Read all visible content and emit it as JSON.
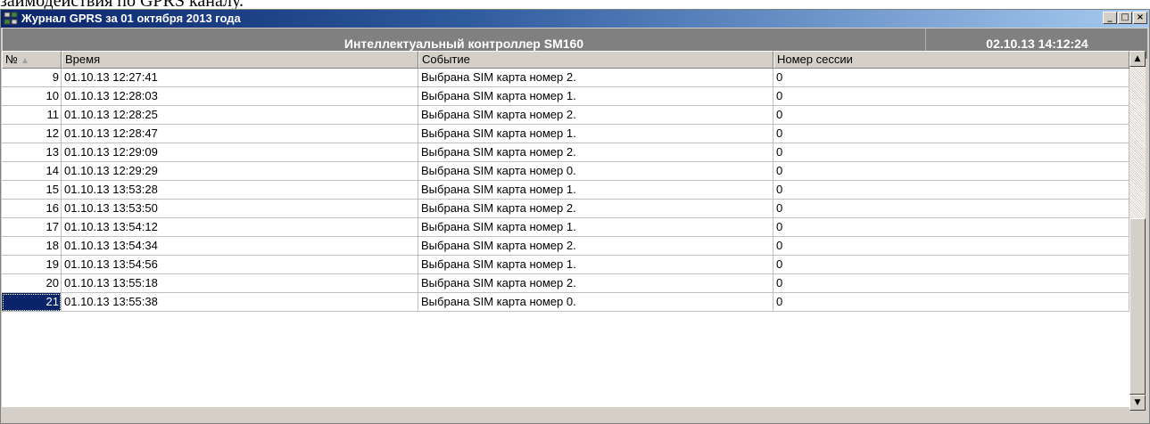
{
  "doc_caption": "заимодействия по GPRS каналу.",
  "window": {
    "title": "Журнал GPRS за 01 октября 2013 года",
    "buttons": {
      "minimize": "_",
      "maximize": "□",
      "close": "×"
    }
  },
  "header": {
    "controller": "Интеллектуальный контроллер SM160",
    "timestamp": "02.10.13 14:12:24"
  },
  "table": {
    "columns": [
      "№",
      "Время",
      "Событие",
      "Номер сессии"
    ],
    "sort_indicator": "▲",
    "selected_row_index": 12,
    "rows": [
      {
        "n": "9",
        "time": "01.10.13 12:27:41",
        "event": "Выбрана SIM карта номер 2.",
        "session": "0"
      },
      {
        "n": "10",
        "time": "01.10.13 12:28:03",
        "event": "Выбрана SIM карта номер 1.",
        "session": "0"
      },
      {
        "n": "11",
        "time": "01.10.13 12:28:25",
        "event": "Выбрана SIM карта номер 2.",
        "session": "0"
      },
      {
        "n": "12",
        "time": "01.10.13 12:28:47",
        "event": "Выбрана SIM карта номер 1.",
        "session": "0"
      },
      {
        "n": "13",
        "time": "01.10.13 12:29:09",
        "event": "Выбрана SIM карта номер 2.",
        "session": "0"
      },
      {
        "n": "14",
        "time": "01.10.13 12:29:29",
        "event": "Выбрана SIM карта номер 0.",
        "session": "0"
      },
      {
        "n": "15",
        "time": "01.10.13 13:53:28",
        "event": "Выбрана SIM карта номер 1.",
        "session": "0"
      },
      {
        "n": "16",
        "time": "01.10.13 13:53:50",
        "event": "Выбрана SIM карта номер 2.",
        "session": "0"
      },
      {
        "n": "17",
        "time": "01.10.13 13:54:12",
        "event": "Выбрана SIM карта номер 1.",
        "session": "0"
      },
      {
        "n": "18",
        "time": "01.10.13 13:54:34",
        "event": "Выбрана SIM карта номер 2.",
        "session": "0"
      },
      {
        "n": "19",
        "time": "01.10.13 13:54:56",
        "event": "Выбрана SIM карта номер 1.",
        "session": "0"
      },
      {
        "n": "20",
        "time": "01.10.13 13:55:18",
        "event": "Выбрана SIM карта номер 2.",
        "session": "0"
      },
      {
        "n": "21",
        "time": "01.10.13 13:55:38",
        "event": "Выбрана SIM карта номер 0.",
        "session": "0"
      }
    ]
  },
  "scrollbar": {
    "up": "▲",
    "down": "▼"
  }
}
